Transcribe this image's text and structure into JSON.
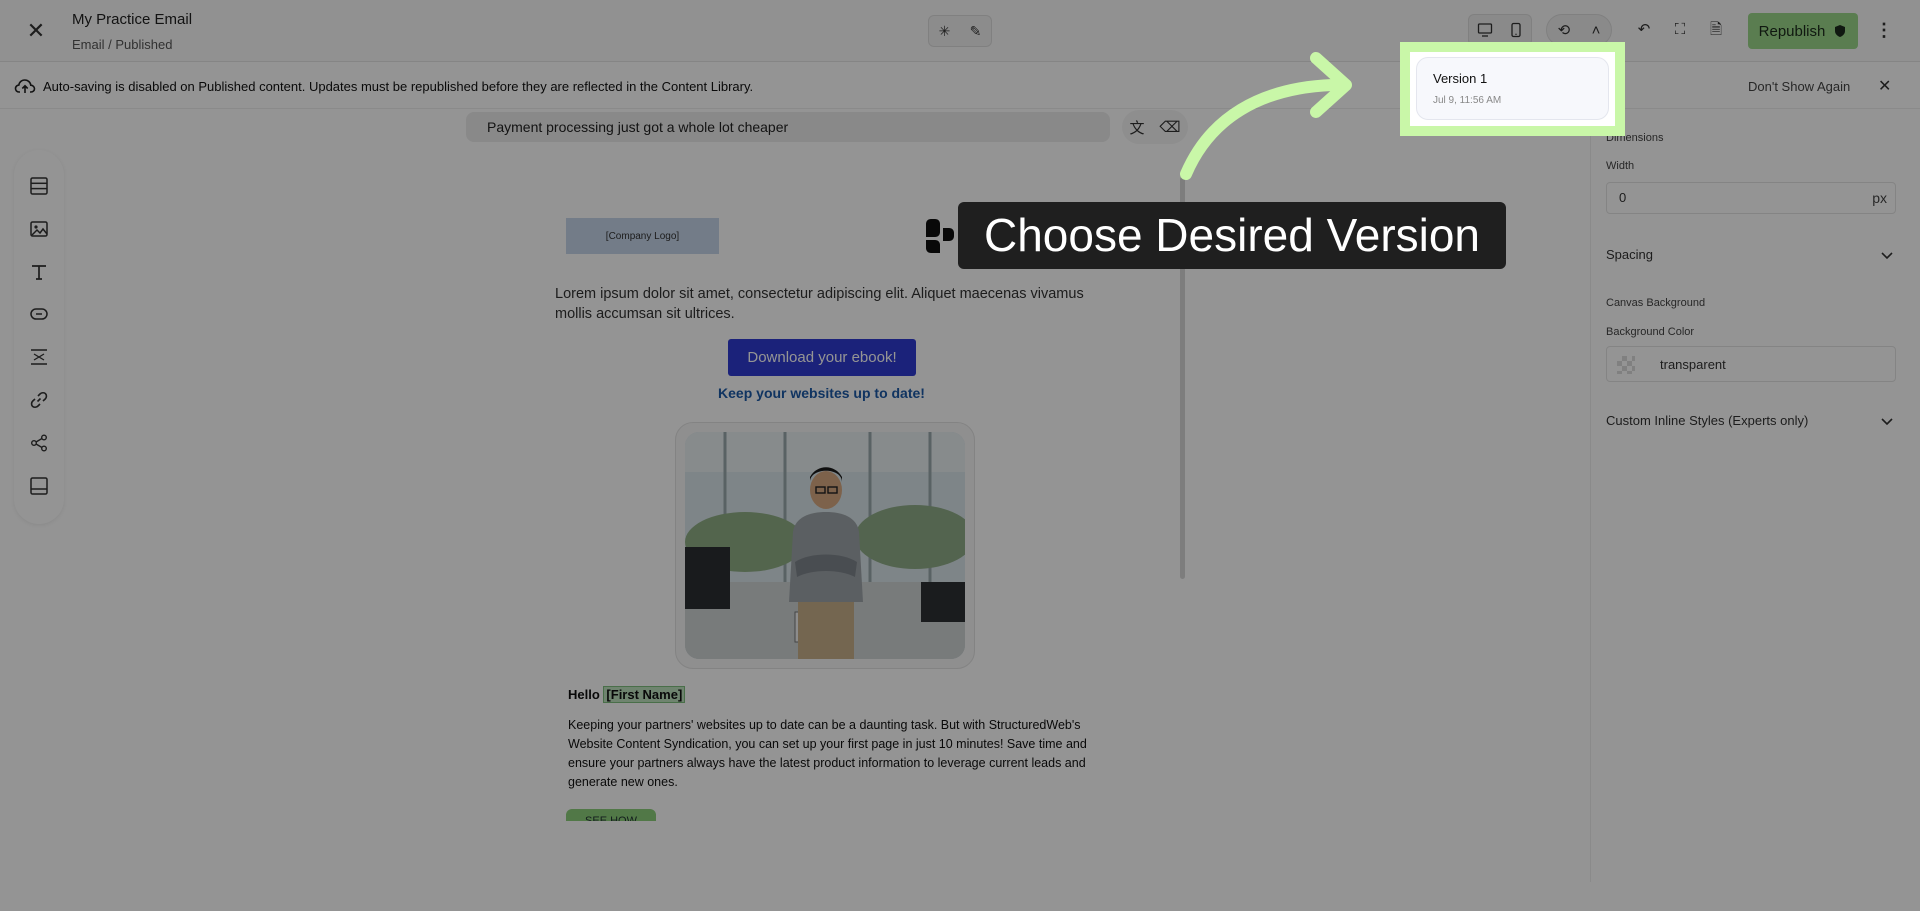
{
  "header": {
    "title": "My Practice Email",
    "breadcrumb": "Email / Published",
    "republish_label": "Republish"
  },
  "infobar": {
    "message": "Auto-saving is disabled on Published content. Updates must be republished before they are reflected in the Content Library.",
    "dont_show_label": "Don't Show Again"
  },
  "subject": {
    "text": "Payment processing just got a whole lot cheaper"
  },
  "email": {
    "logo_text": "[Company Logo]",
    "intro": "Lorem ipsum dolor sit amet, consectetur adipiscing elit. Aliquet maecenas vivamus mollis accumsan sit ultrices.",
    "cta_label": "Download your ebook!",
    "link_text": "Keep your websites up to date!",
    "greeting": "Hello",
    "merge_tag": "[First Name]",
    "body": "Keeping your partners' websites up to date can be a daunting task. But with StructuredWeb's Website Content Syndication, you can set up your first page in just 10 minutes! Save time and ensure your partners always have the latest product information to leverage current leads and generate new ones.",
    "secondary_cta": "SEE HOW"
  },
  "panel": {
    "dimensions_label": "Dimensions",
    "width_label": "Width",
    "width_value": "0",
    "width_unit": "px",
    "spacing_label": "Spacing",
    "canvas_bg_label": "Canvas Background",
    "bg_color_label": "Background Color",
    "bg_color_value": "transparent",
    "custom_styles_label": "Custom Inline Styles (Experts only)"
  },
  "version_popup": {
    "name": "Version 1",
    "date": "Jul 9, 11:56 AM"
  },
  "callout": {
    "text": "Choose Desired Version"
  },
  "colors": {
    "republish": "#9bd88a",
    "highlight": "#c9f7a8",
    "cta": "#2f3bd2",
    "link": "#1d5aa8"
  }
}
